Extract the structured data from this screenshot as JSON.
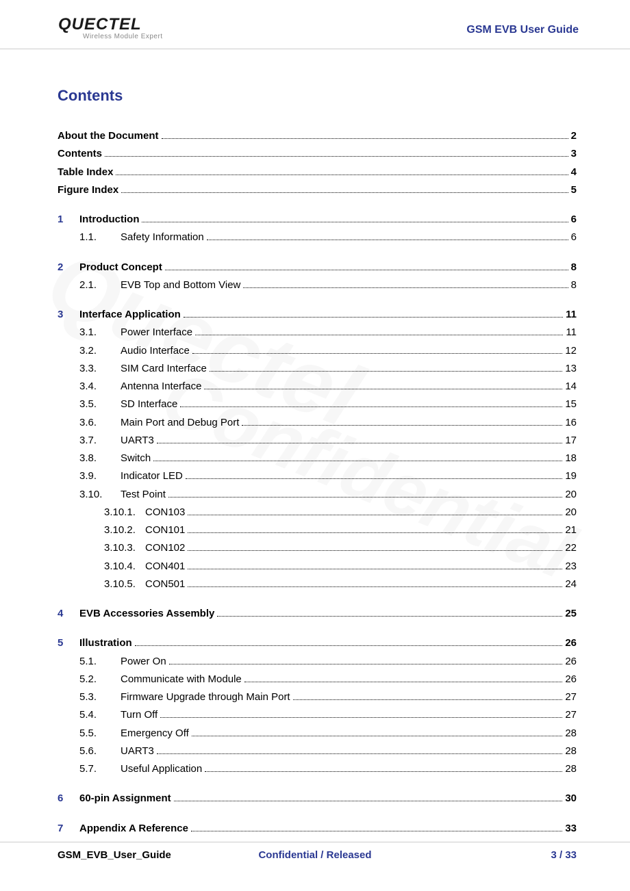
{
  "header": {
    "logo_text": "QUECTEL",
    "logo_sub": "Wireless Module Expert",
    "title": "GSM EVB User Guide"
  },
  "heading": "Contents",
  "front_matter": [
    {
      "label": "About the Document",
      "page": "2"
    },
    {
      "label": "Contents",
      "page": "3"
    },
    {
      "label": "Table Index",
      "page": "4"
    },
    {
      "label": "Figure Index",
      "page": "5"
    }
  ],
  "sections": [
    {
      "num": "1",
      "label": "Introduction",
      "page": "6",
      "subs": [
        {
          "num": "1.1.",
          "label": "Safety Information",
          "page": "6"
        }
      ]
    },
    {
      "num": "2",
      "label": "Product Concept",
      "page": "8",
      "subs": [
        {
          "num": "2.1.",
          "label": "EVB Top and Bottom View",
          "page": "8"
        }
      ]
    },
    {
      "num": "3",
      "label": "Interface Application",
      "page": "11",
      "subs": [
        {
          "num": "3.1.",
          "label": "Power Interface",
          "page": "11"
        },
        {
          "num": "3.2.",
          "label": "Audio Interface",
          "page": "12"
        },
        {
          "num": "3.3.",
          "label": "SIM Card Interface",
          "page": "13"
        },
        {
          "num": "3.4.",
          "label": "Antenna Interface",
          "page": "14"
        },
        {
          "num": "3.5.",
          "label": "SD Interface",
          "page": "15"
        },
        {
          "num": "3.6.",
          "label": "Main Port and Debug Port",
          "page": "16"
        },
        {
          "num": "3.7.",
          "label": "UART3",
          "page": "17"
        },
        {
          "num": "3.8.",
          "label": "Switch",
          "page": "18"
        },
        {
          "num": "3.9.",
          "label": "Indicator LED",
          "page": "19"
        },
        {
          "num": "3.10.",
          "label": "Test Point",
          "page": "20",
          "subs": [
            {
              "num": "3.10.1.",
              "label": "CON103",
              "page": "20"
            },
            {
              "num": "3.10.2.",
              "label": "CON101",
              "page": "21"
            },
            {
              "num": "3.10.3.",
              "label": "CON102",
              "page": "22"
            },
            {
              "num": "3.10.4.",
              "label": "CON401",
              "page": "23"
            },
            {
              "num": "3.10.5.",
              "label": "CON501",
              "page": "24"
            }
          ]
        }
      ]
    },
    {
      "num": "4",
      "label": "EVB Accessories Assembly",
      "page": "25",
      "subs": []
    },
    {
      "num": "5",
      "label": "Illustration",
      "page": "26",
      "subs": [
        {
          "num": "5.1.",
          "label": "Power On",
          "page": "26"
        },
        {
          "num": "5.2.",
          "label": "Communicate with Module",
          "page": "26"
        },
        {
          "num": "5.3.",
          "label": "Firmware Upgrade through Main Port",
          "page": "27"
        },
        {
          "num": "5.4.",
          "label": "Turn Off",
          "page": "27"
        },
        {
          "num": "5.5.",
          "label": "Emergency Off",
          "page": "28"
        },
        {
          "num": "5.6.",
          "label": "UART3",
          "page": "28"
        },
        {
          "num": "5.7.",
          "label": "Useful Application",
          "page": "28"
        }
      ]
    },
    {
      "num": "6",
      "label": "60-pin Assignment",
      "page": "30",
      "subs": []
    },
    {
      "num": "7",
      "label": "Appendix A Reference",
      "page": "33",
      "subs": []
    }
  ],
  "footer": {
    "left": "GSM_EVB_User_Guide",
    "center": "Confidential / Released",
    "right": "3 / 33"
  }
}
